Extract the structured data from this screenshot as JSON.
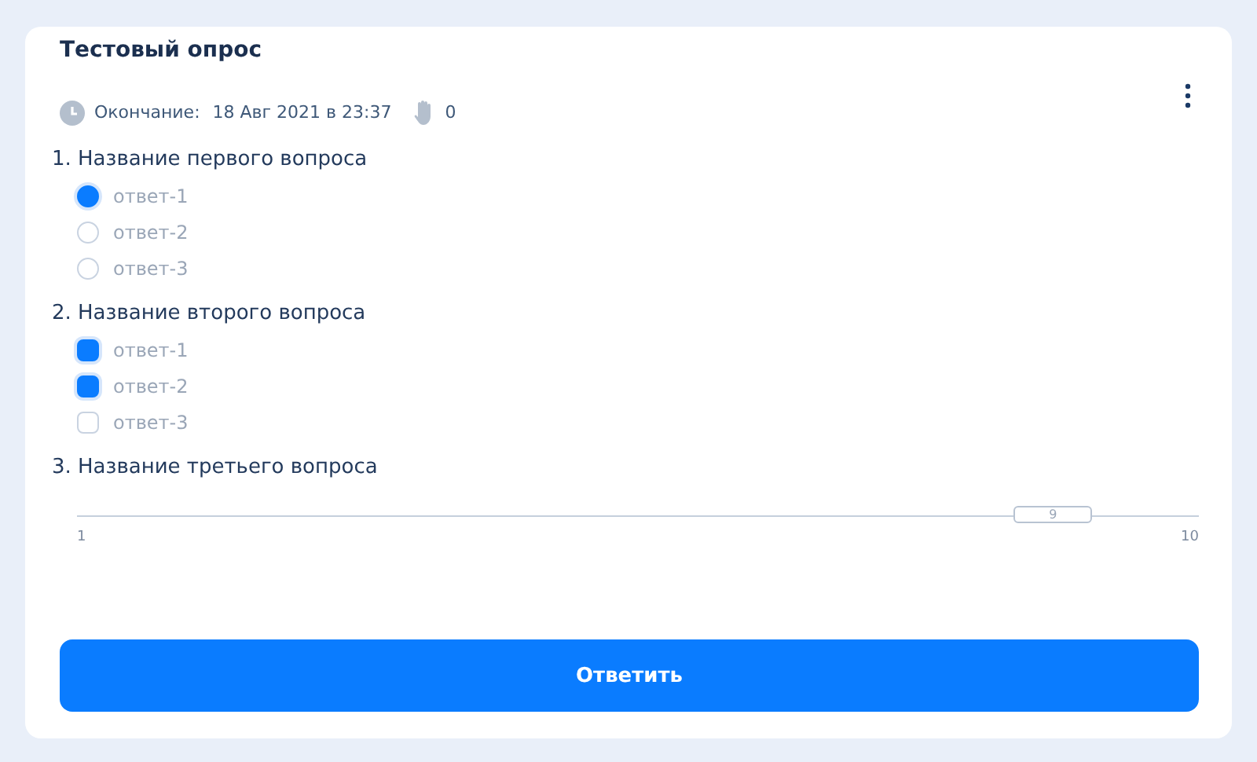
{
  "poll": {
    "title": "Тестовый опрос",
    "end_label": "Окончание:",
    "end_date": "18 Авг 2021 в 23:37",
    "votes": "0"
  },
  "questions": [
    {
      "kind": "radio",
      "title": "1. Название первого вопроса",
      "options": [
        {
          "label": "ответ-1",
          "selected": true
        },
        {
          "label": "ответ-2",
          "selected": false
        },
        {
          "label": "ответ-3",
          "selected": false
        }
      ]
    },
    {
      "kind": "checkbox",
      "title": "2. Название второго вопроса",
      "options": [
        {
          "label": "ответ-1",
          "checked": true
        },
        {
          "label": "ответ-2",
          "checked": true
        },
        {
          "label": "ответ-3",
          "checked": false
        }
      ]
    },
    {
      "kind": "slider",
      "title": "3. Название третьего вопроса",
      "min": "1",
      "max": "10",
      "value": "9",
      "level": 0.87
    }
  ],
  "submit": "Ответить"
}
